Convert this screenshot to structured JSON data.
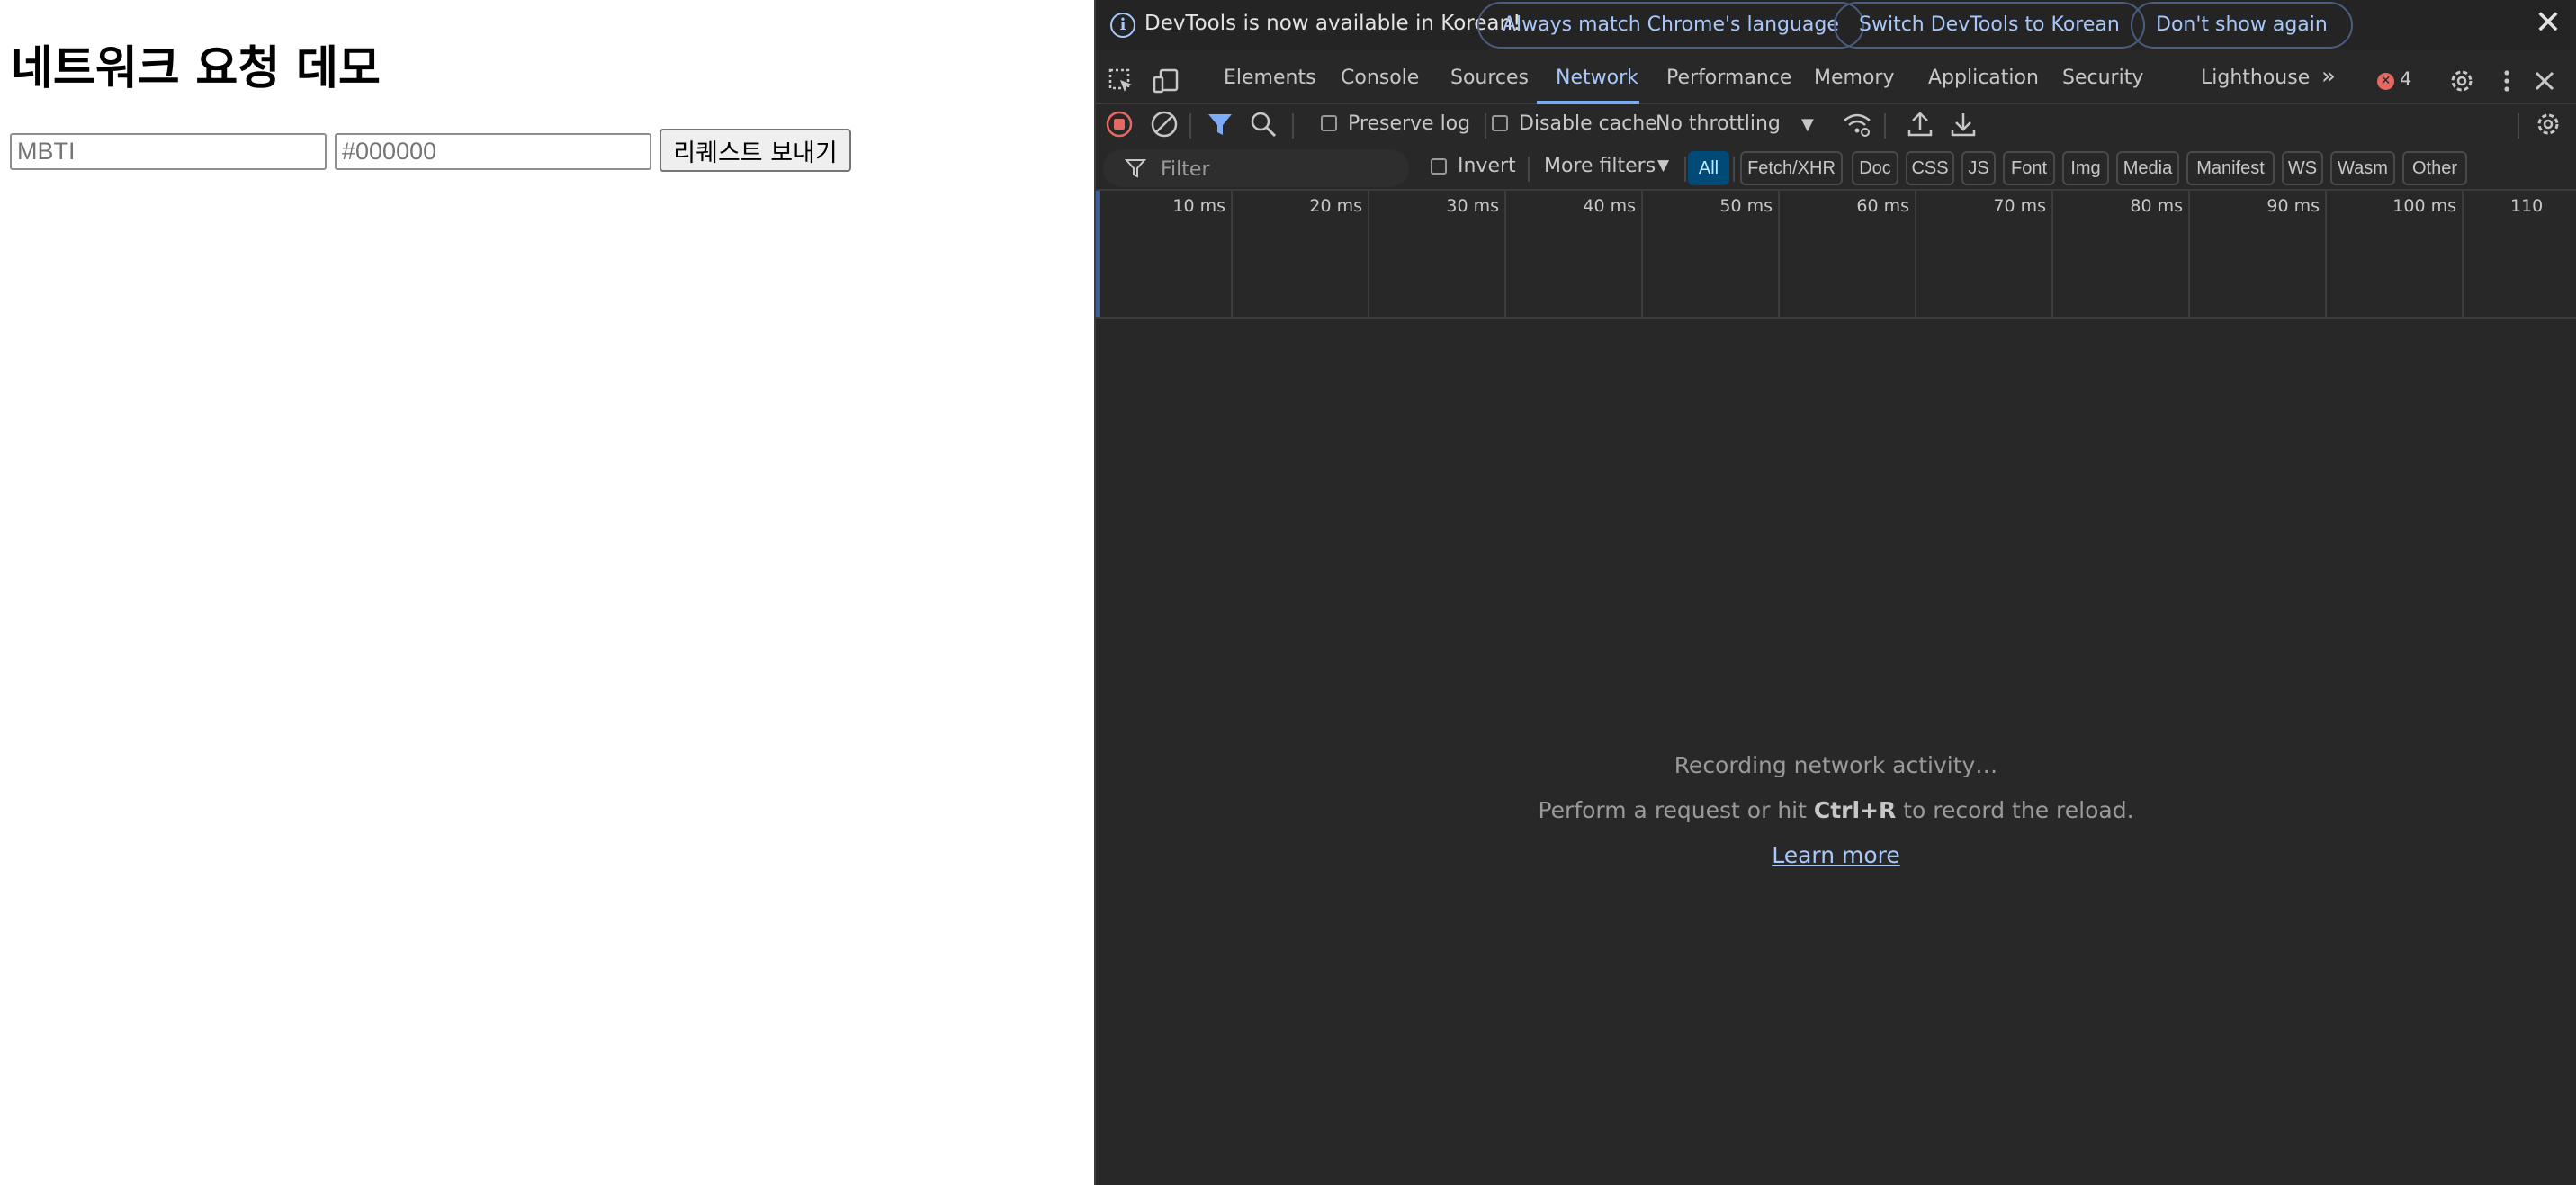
{
  "page": {
    "title": "네트워크 요청 데모",
    "mbti_placeholder": "MBTI",
    "color_placeholder": "#000000",
    "submit_label": "리퀘스트 보내기"
  },
  "devtools": {
    "infobar": {
      "message": "DevTools is now available in Korean!",
      "btn_match": "Always match Chrome's language",
      "btn_switch": "Switch DevTools to Korean",
      "btn_dismiss": "Don't show again"
    },
    "tabs": [
      "Elements",
      "Console",
      "Sources",
      "Network",
      "Performance",
      "Memory",
      "Application",
      "Security",
      "Lighthouse"
    ],
    "active_tab": "Network",
    "error_count": "4",
    "toolbar": {
      "preserve_log": "Preserve log",
      "disable_cache": "Disable cache",
      "throttling": "No throttling"
    },
    "filter": {
      "placeholder": "Filter",
      "invert": "Invert",
      "more_filters": "More filters",
      "types": [
        "All",
        "Fetch/XHR",
        "Doc",
        "CSS",
        "JS",
        "Font",
        "Img",
        "Media",
        "Manifest",
        "WS",
        "Wasm",
        "Other"
      ]
    },
    "timeline_ticks": [
      "10 ms",
      "20 ms",
      "30 ms",
      "40 ms",
      "50 ms",
      "60 ms",
      "70 ms",
      "80 ms",
      "90 ms",
      "100 ms",
      "110"
    ],
    "empty_state": {
      "title": "Recording network activity…",
      "hint_prefix": "Perform a request or hit ",
      "hint_keys": "Ctrl+R",
      "hint_suffix": " to record the reload.",
      "learn_more": "Learn more"
    },
    "colors": {
      "accent": "#a8c7fa",
      "record": "#e46962",
      "panel_bg": "#282828"
    }
  }
}
